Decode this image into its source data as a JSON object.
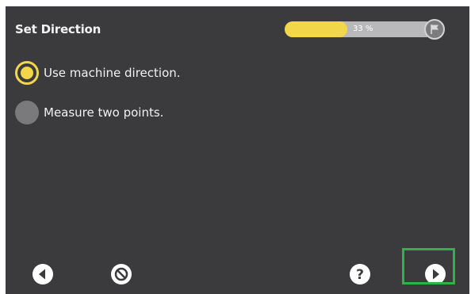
{
  "header": {
    "title": "Set Direction",
    "progress_percent": 33,
    "progress_label": "33 %"
  },
  "options": [
    {
      "label": "Use machine direction.",
      "selected": true
    },
    {
      "label": "Measure two points.",
      "selected": false
    }
  ],
  "footer": {
    "buttons": [
      "back-icon",
      "cancel-icon",
      "help-icon",
      "next-icon"
    ]
  },
  "colors": {
    "background": "#3b3b3d",
    "accent": "#f2d74a",
    "highlight": "#2fb24a"
  }
}
